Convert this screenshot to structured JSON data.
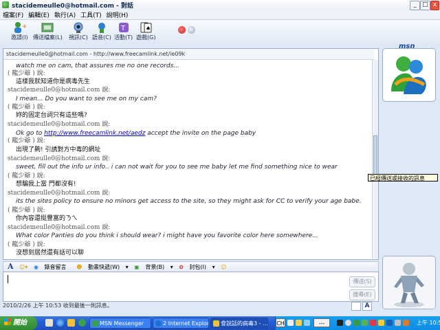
{
  "window": {
    "title": "stacidemeulle0@hotmail.com - 對話"
  },
  "menu": [
    "檔案(F)",
    "編輯(E)",
    "執行(A)",
    "工具(T)",
    "說明(H)"
  ],
  "toolbar": [
    {
      "label": "邀請(I)",
      "icon": "invite-icon"
    },
    {
      "label": "傳送檔案(L)",
      "icon": "send-file-icon"
    },
    {
      "label": "視訊(C)",
      "icon": "webcam-icon"
    },
    {
      "label": "語音(C)",
      "icon": "voice-icon"
    },
    {
      "label": "活動(T)",
      "icon": "activities-icon"
    },
    {
      "label": "遊戲(G)",
      "icon": "games-icon"
    }
  ],
  "brand": "msn",
  "to_header": "stacidemeulle0@hotmail.com - http://www.freecamlink.net/ie09k",
  "messages": [
    {
      "kind": "en",
      "text": "watch me on cam, that assures me no one records..."
    },
    {
      "kind": "hdr",
      "text": "( 龍少爺 ) 說:"
    },
    {
      "kind": "zh",
      "text": "這樣我就知道你是病毒先生"
    },
    {
      "kind": "hdr",
      "text": "stacidemeulle0@hotmail.com 說:"
    },
    {
      "kind": "en",
      "text": "I mean... Do you want to see me on my cam?"
    },
    {
      "kind": "hdr",
      "text": "( 龍少爺 ) 說:"
    },
    {
      "kind": "zh",
      "text": "妳的固定台詞只有這些嗎?"
    },
    {
      "kind": "hdr",
      "text": "stacidemeulle0@hotmail.com 說:"
    },
    {
      "kind": "link",
      "before": "Ok go to ",
      "link": "http://www.freecamlink.net/aedz",
      "after": " accept the invite on the page baby"
    },
    {
      "kind": "hdr",
      "text": "( 龍少爺 ) 說:"
    },
    {
      "kind": "zh",
      "text": "出現了齁! 引誘對方中毒的網址"
    },
    {
      "kind": "hdr",
      "text": "stacidemeulle0@hotmail.com 說:"
    },
    {
      "kind": "en",
      "text": "sweet, fill out the info ur info.. i can not wait for you to see me baby let me find something nice to wear"
    },
    {
      "kind": "hdr",
      "text": "( 龍少爺 ) 說:"
    },
    {
      "kind": "zh",
      "text": "想騙我上當 門都沒有!"
    },
    {
      "kind": "hdr",
      "text": "stacidemeulle0@hotmail.com 說:"
    },
    {
      "kind": "en",
      "text": "its the sites policy to ensure no minors get access to the site, so they might ask for CC to verify your age babe."
    },
    {
      "kind": "hdr",
      "text": "( 龍少爺 ) 說:"
    },
    {
      "kind": "zh",
      "text": "你內容還挺豐富的ㄋㄟ"
    },
    {
      "kind": "hdr",
      "text": "stacidemeulle0@hotmail.com 說:"
    },
    {
      "kind": "en",
      "text": "What color Panties do you think i should wear? i might have you favorite color here somewhere..."
    },
    {
      "kind": "hdr",
      "text": "( 龍少爺 ) 說:"
    },
    {
      "kind": "zh",
      "text": "沒想到居然還有話可以聊"
    }
  ],
  "format_bar": [
    "錄音留言",
    "動畫快遞(W)",
    "背景(B)",
    "封包(I)"
  ],
  "input": {
    "value": ""
  },
  "buttons": {
    "send": "傳送(S)",
    "search": "搜尋(E)"
  },
  "status": "2010/2/26 上午 10:53 收到最後一則訊息。",
  "tooltip": "已經傳送或接收的訊息",
  "taskbar": {
    "start": "開始",
    "tasks": [
      {
        "label": "MSN Messenger",
        "active": false
      },
      {
        "label": "2 Internet Explorer",
        "active": false
      },
      {
        "label": "會說話的病毒3 - ...",
        "active": true
      }
    ],
    "tray": {
      "ime": "CH",
      "input_box": "---",
      "clock": "上午 10:57"
    }
  }
}
